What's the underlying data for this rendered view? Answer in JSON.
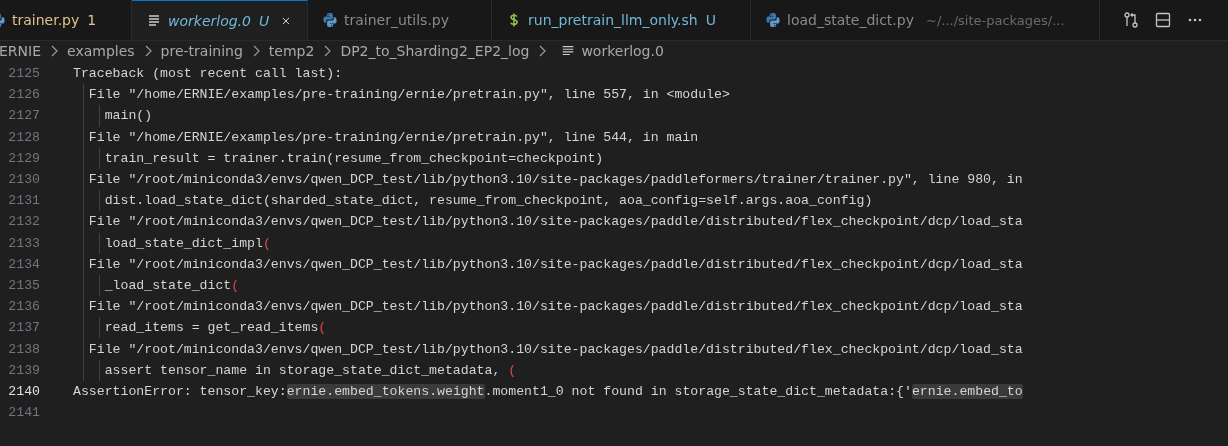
{
  "tabs": [
    {
      "label": "trainer.py",
      "badge": "1",
      "kind": "python",
      "color": "#e2c08d",
      "selected": false,
      "preview": false
    },
    {
      "label": "workerlog.0",
      "badge": "U",
      "kind": "text",
      "color": "#6fb8d6",
      "selected": true,
      "preview": true
    },
    {
      "label": "trainer_utils.py",
      "kind": "python",
      "color": "#8a8a8a",
      "selected": false,
      "preview": false
    },
    {
      "label": "run_pretrain_llm_only.sh",
      "badge": "U",
      "kind": "shell",
      "color": "#6fb8d6",
      "selected": false,
      "preview": false
    },
    {
      "label": "load_state_dict.py",
      "description": "~/.../site-packages/...",
      "kind": "python",
      "color": "#8a8a8a",
      "selected": false,
      "preview": false
    }
  ],
  "breadcrumbs": [
    "ERNIE",
    "examples",
    "pre-training",
    "temp2",
    "DP2_to_Sharding2_EP2_log",
    "workerlog.0"
  ],
  "lines": [
    {
      "number": "2125",
      "current": false,
      "segments": [
        {
          "kind": "plain",
          "text": "Traceback (most recent call last):"
        }
      ]
    },
    {
      "number": "2126",
      "current": false,
      "segments": [
        {
          "kind": "plain",
          "text": "  File \"/home/ERNIE/examples/pre-training/ernie/pretrain.py\", line 557, in <module>"
        }
      ]
    },
    {
      "number": "2127",
      "current": false,
      "segments": [
        {
          "kind": "plain",
          "text": "    main()"
        }
      ]
    },
    {
      "number": "2128",
      "current": false,
      "segments": [
        {
          "kind": "plain",
          "text": "  File \"/home/ERNIE/examples/pre-training/ernie/pretrain.py\", line 544, in main"
        }
      ]
    },
    {
      "number": "2129",
      "current": false,
      "segments": [
        {
          "kind": "plain",
          "text": "    train_result = trainer.train(resume_from_checkpoint=checkpoint)"
        }
      ]
    },
    {
      "number": "2130",
      "current": false,
      "segments": [
        {
          "kind": "plain",
          "text": "  File \"/root/miniconda3/envs/qwen_DCP_test/lib/python3.10/site-packages/paddleformers/trainer/trainer.py\", line 980, in"
        }
      ]
    },
    {
      "number": "2131",
      "current": false,
      "segments": [
        {
          "kind": "plain",
          "text": "    dist.load_state_dict(sharded_state_dict, resume_from_checkpoint, aoa_config=self.args.aoa_config)"
        }
      ]
    },
    {
      "number": "2132",
      "current": false,
      "segments": [
        {
          "kind": "plain",
          "text": "  File \"/root/miniconda3/envs/qwen_DCP_test/lib/python3.10/site-packages/paddle/distributed/flex_checkpoint/dcp/load_sta"
        }
      ]
    },
    {
      "number": "2133",
      "current": false,
      "segments": [
        {
          "kind": "plain",
          "text": "    load_state_dict_impl"
        },
        {
          "kind": "paren",
          "text": "("
        }
      ]
    },
    {
      "number": "2134",
      "current": false,
      "segments": [
        {
          "kind": "plain",
          "text": "  File \"/root/miniconda3/envs/qwen_DCP_test/lib/python3.10/site-packages/paddle/distributed/flex_checkpoint/dcp/load_sta"
        }
      ]
    },
    {
      "number": "2135",
      "current": false,
      "segments": [
        {
          "kind": "plain",
          "text": "    _load_state_dict"
        },
        {
          "kind": "paren",
          "text": "("
        }
      ]
    },
    {
      "number": "2136",
      "current": false,
      "segments": [
        {
          "kind": "plain",
          "text": "  File \"/root/miniconda3/envs/qwen_DCP_test/lib/python3.10/site-packages/paddle/distributed/flex_checkpoint/dcp/load_sta"
        }
      ]
    },
    {
      "number": "2137",
      "current": false,
      "segments": [
        {
          "kind": "plain",
          "text": "    read_items = get_read_items"
        },
        {
          "kind": "paren",
          "text": "("
        }
      ]
    },
    {
      "number": "2138",
      "current": false,
      "segments": [
        {
          "kind": "plain",
          "text": "  File \"/root/miniconda3/envs/qwen_DCP_test/lib/python3.10/site-packages/paddle/distributed/flex_checkpoint/dcp/load_sta"
        }
      ]
    },
    {
      "number": "2139",
      "current": false,
      "segments": [
        {
          "kind": "plain",
          "text": "    assert tensor_name in storage_state_dict_metadata, "
        },
        {
          "kind": "paren",
          "text": "("
        }
      ]
    },
    {
      "number": "2140",
      "current": true,
      "segments": [
        {
          "kind": "plain",
          "text": "AssertionError: tensor_key:"
        },
        {
          "kind": "highlight",
          "text": "ernie.embed_tokens.weight"
        },
        {
          "kind": "plain",
          "text": ".moment1_0 not found in storage_state_dict_metadata:{'"
        },
        {
          "kind": "highlight",
          "text": "ernie.embed_to"
        }
      ]
    },
    {
      "number": "2141",
      "current": false
    }
  ]
}
